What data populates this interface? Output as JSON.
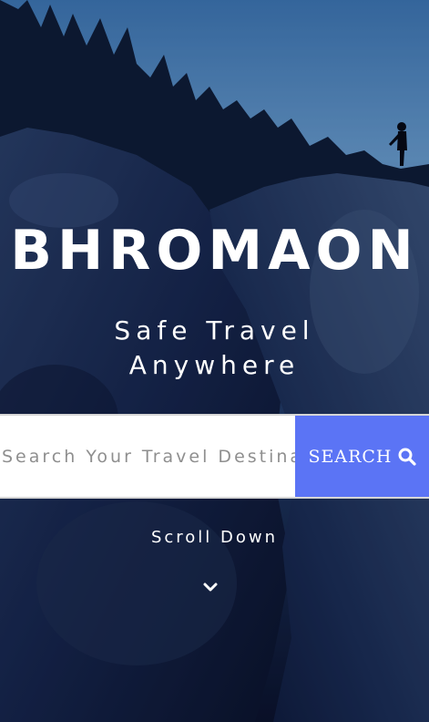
{
  "hero": {
    "title": "BHROMAON",
    "tagline_line1": "Safe Travel",
    "tagline_line2": "Anywhere"
  },
  "search": {
    "placeholder": "Search Your Travel Destination",
    "button_label": "SEARCH",
    "button_icon": "search-icon",
    "button_color": "#5b74f5"
  },
  "scroll": {
    "label": "Scroll Down",
    "icon": "chevron-down-icon"
  }
}
